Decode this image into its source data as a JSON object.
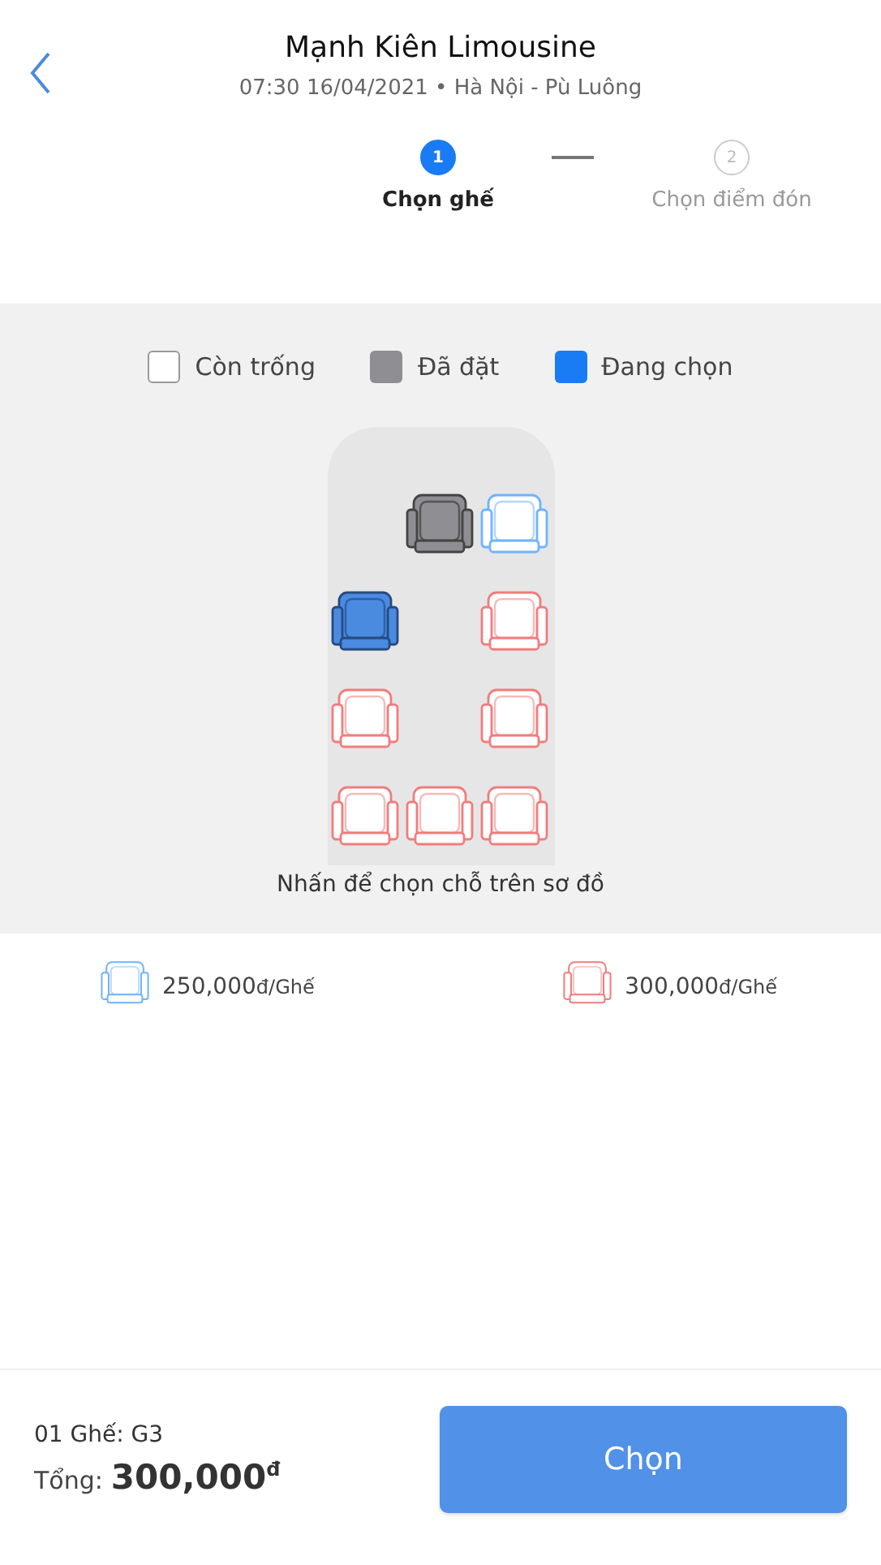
{
  "header": {
    "title": "Mạnh Kiên Limousine",
    "subtitle": "07:30 16/04/2021 • Hà Nội - Pù Luông"
  },
  "steps": [
    {
      "number": "1",
      "label": "Chọn ghế",
      "selected": true
    },
    {
      "number": "2",
      "label": "Chọn điểm đón",
      "selected": false
    }
  ],
  "legend": [
    {
      "label": "Còn trống",
      "kind": "available"
    },
    {
      "label": "Đã đặt",
      "kind": "booked"
    },
    {
      "label": "Đang chọn",
      "kind": "selected"
    }
  ],
  "seat_rows": [
    [
      {
        "kind": "gap"
      },
      {
        "kind": "seat",
        "booked": true,
        "selected": false
      },
      {
        "kind": "seat",
        "booked": false,
        "selected": false,
        "color": "#6fb3ff"
      }
    ],
    [
      {
        "kind": "seat",
        "booked": false,
        "selected": true
      },
      {
        "kind": "gap"
      },
      {
        "kind": "seat",
        "booked": false,
        "selected": false,
        "color": "#f27c7c"
      }
    ],
    [
      {
        "kind": "seat",
        "booked": false,
        "selected": false,
        "color": "#f27c7c"
      },
      {
        "kind": "gap"
      },
      {
        "kind": "seat",
        "booked": false,
        "selected": false,
        "color": "#f27c7c"
      }
    ],
    [
      {
        "kind": "seat",
        "booked": false,
        "selected": false,
        "color": "#f27c7c"
      },
      {
        "kind": "seat",
        "booked": false,
        "selected": false,
        "color": "#f27c7c"
      },
      {
        "kind": "seat",
        "booked": false,
        "selected": false,
        "color": "#f27c7c"
      }
    ]
  ],
  "map_hint": "Nhấn để chọn chỗ trên sơ đồ",
  "prices": [
    {
      "color": "#6fb3ff",
      "amount": "250,000",
      "unit": "đ/Ghế"
    },
    {
      "color": "#f27c7c",
      "amount": "300,000",
      "unit": "đ/Ghế"
    }
  ],
  "summary": {
    "seats": "01 Ghế: G3",
    "total_label": "Tổng:",
    "total": "300,000",
    "currency": "đ"
  },
  "button": "Chọn"
}
